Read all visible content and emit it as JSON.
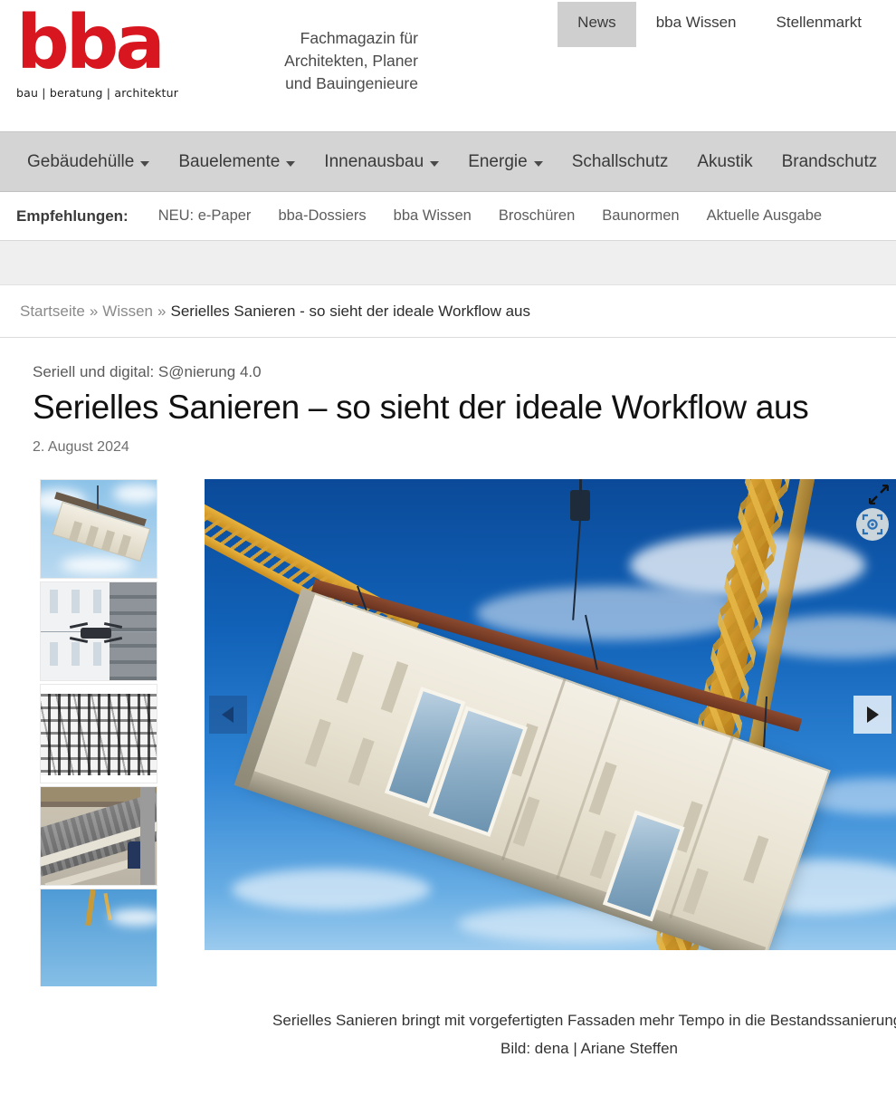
{
  "brand": {
    "logo_text": "bba",
    "logo_subtitle": "bau | beratung | architektur",
    "tagline_line1": "Fachmagazin für",
    "tagline_line2": "Architekten, Planer",
    "tagline_line3": "und Bauingenieure",
    "accent_color": "#d8161f"
  },
  "top_nav": {
    "items": [
      {
        "label": "News",
        "active": true
      },
      {
        "label": "bba Wissen",
        "active": false
      },
      {
        "label": "Stellenmarkt",
        "active": false
      }
    ]
  },
  "main_nav": {
    "items": [
      {
        "label": "Gebäudehülle",
        "has_dropdown": true
      },
      {
        "label": "Bauelemente",
        "has_dropdown": true
      },
      {
        "label": "Innenausbau",
        "has_dropdown": true
      },
      {
        "label": "Energie",
        "has_dropdown": true
      },
      {
        "label": "Schallschutz",
        "has_dropdown": false
      },
      {
        "label": "Akustik",
        "has_dropdown": false
      },
      {
        "label": "Brandschutz",
        "has_dropdown": false
      }
    ]
  },
  "recommendations": {
    "label": "Empfehlungen:",
    "items": [
      {
        "label": "NEU: e-Paper"
      },
      {
        "label": "bba-Dossiers"
      },
      {
        "label": "bba Wissen"
      },
      {
        "label": "Broschüren"
      },
      {
        "label": "Baunormen"
      },
      {
        "label": "Aktuelle Ausgabe"
      }
    ]
  },
  "breadcrumb": {
    "items": [
      {
        "label": "Startseite",
        "current": false
      },
      {
        "label": "Wissen",
        "current": false
      },
      {
        "label": "Serielles Sanieren - so sieht der ideale Workflow aus",
        "current": true
      }
    ],
    "separator": "»"
  },
  "article": {
    "kicker": "Seriell und digital: S@nierung 4.0",
    "headline": "Serielles Sanieren – so sieht der ideale Workflow aus",
    "date": "2. August 2024"
  },
  "gallery": {
    "prev_label": "◀",
    "next_label": "▶",
    "expand_icon": "expand-arrows-icon",
    "badge_icon": "photo-focus-icon",
    "thumbnails": [
      {
        "alt": "Vorgefertigtes Fassadenelement am Kran vor blauem Himmel"
      },
      {
        "alt": "Drohne vermisst Plattenbaufassade"
      },
      {
        "alt": "Schwarz-weiß Punktwolke eines Gebäudes"
      },
      {
        "alt": "Dachelement-Vorfertigung in der Werkshalle"
      },
      {
        "alt": "Kran mit Fassadenelement vor blauem Himmel"
      }
    ],
    "caption_line1": "Serielles Sanieren bringt mit vorgefertigten Fassaden mehr Tempo in die",
    "caption_line2": "Bestandssanierung. Bild: dena | Ariane Steffen",
    "main_image_alt": "Vorgefertigtes Fassadenelement hängt am Kranhaken vor blauem Himmel"
  }
}
